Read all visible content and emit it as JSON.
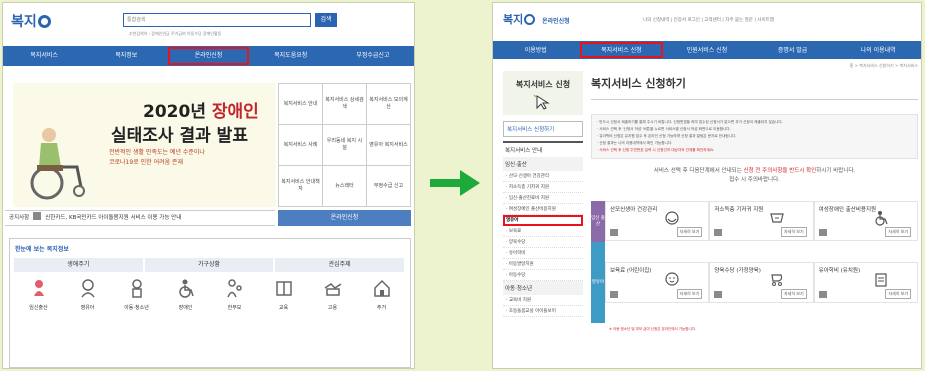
{
  "left": {
    "logo_text": "복지",
    "search_placeholder": "통합검색",
    "search_button": "검색",
    "popular_keywords": "추천검색어 : 장애인연금  주거급여  아동수당  장애인활동",
    "nav": [
      "복지서비스",
      "복지정보",
      "온라인신청",
      "복지도움요청",
      "부정수급신고"
    ],
    "nav_highlight_index": 2,
    "banner": {
      "title_prefix": "2020년 ",
      "title_accent": "장애인",
      "title_line2": "실태조사 결과 발표",
      "sub1": "전반적인 생활 만족도는 예년 수준이나",
      "sub2": "코로나19로 인한 어려움 존재"
    },
    "quick_links": [
      "복지서비스 안내",
      "복지서비스 상세검색",
      "복지서비스 모의계산",
      "복지서비스 사례",
      "우리동네 복지 시설",
      "영유아 복지서비스",
      "복지서비스 안내책자",
      "뉴스레터",
      "부정수급 신고"
    ],
    "notice_label": "공지사항",
    "notice_text": "신한카드, KB국민카드 아이돌봄지원 서비스 이용 가능 안내",
    "online_button": "온라인신청",
    "welfare_panel": {
      "title": "한눈에 보는 복지정보",
      "categories": [
        "생애주기",
        "가구상황",
        "관심주제"
      ],
      "items": [
        "임신출산",
        "영유아",
        "아동·청소년",
        "장애인",
        "한부모",
        "교육",
        "고용",
        "주거"
      ]
    }
  },
  "right": {
    "logo_text": "복지",
    "logo_sub": "온라인신청",
    "top_links": "나의 신청내역 | 인증서 로그인 | 고객센터 | 자주 묻는 질문 | 사이트맵",
    "nav": [
      "이용방법",
      "복지서비스 신청",
      "민원서비스 신청",
      "증명서 발급",
      "나의 이용내역"
    ],
    "nav_highlight_index": 1,
    "sidebar": {
      "title": "복지서비스 신청",
      "guide_button": "복지서비스 신청하기",
      "section": "복지서비스 안내",
      "category1": "임신·출산",
      "items1": [
        "· 산모·신생아 건강관리",
        "· 저소득층 기저귀 지원",
        "· 임신·출산진료비 지원",
        "· 여성장애인 출산비용지원"
      ],
      "selected_item": "영유아",
      "items2": [
        "· 보육료",
        "· 양육수당",
        "· 유아학비",
        "· 아동발달지원",
        "· 아동수당"
      ],
      "category2": "아동·청소년",
      "items3": [
        "· 교육비 지원",
        "· 초등돌봄교실 아이돌보미"
      ]
    },
    "breadcrumb": "홈 > 복지서비스 신청하기 > 복지서비스",
    "page_title": "복지서비스 신청하기",
    "guide_lines": [
      "· 반드시 신청서 제출하기를 통해 주시기 바랍니다. 신청변경을 하여 접수된 신청서가 없으면 추가 신청이 제출되지 않습니다.",
      "· 서비스 선택 후 '신청서 작성' 버튼을 누르면 서비스별 신청서 작성 화면으로 이동합니다.",
      "· 유아학비 신청은 유치원 접수 후 온라인 신청 가능하며 신청 결과 알림은 문자로 안내됩니다.",
      "· 신청 결과는 나의 이용내역에서 확인 가능합니다.",
      "· 서비스 선택 후 신청 주민번호 입력 시 신청인과 대상자의 관계를 확인하세요."
    ],
    "note_line1_prefix": "서비스 선택 후 다음단계에서 안내되는 ",
    "note_line1_red": "신청 전 주의사항을 반드시 확인",
    "note_line1_suffix": "하시기 바랍니다.",
    "note_line2": "접수 시 주의바랍니다.",
    "svc_group_labels": [
      "임신 출산",
      "영유아"
    ],
    "services": [
      {
        "name": "산모신생아 건강관리",
        "icon": "mother-baby-icon"
      },
      {
        "name": "저소득층 기저귀 지원",
        "icon": "diaper-icon"
      },
      {
        "name": "여성장애인 출산비용지원",
        "icon": "wheelchair-icon"
      },
      {
        "name": "보육료 (어린이집)",
        "icon": "child-face-icon"
      },
      {
        "name": "양육수당 (가정양육)",
        "icon": "stroller-icon"
      },
      {
        "name": "유아학비 (유치원)",
        "icon": "clipboard-icon"
      }
    ],
    "view_label": "자세히 보기",
    "footer_note": "※ 아동·청소년 및 부모 급여 신청은 온라인에서 가능합니다."
  },
  "colors": {
    "brand": "#2c67b2",
    "highlight": "#e8141d",
    "arrow": "#1eaa3a",
    "bg": "#eef3cf"
  }
}
